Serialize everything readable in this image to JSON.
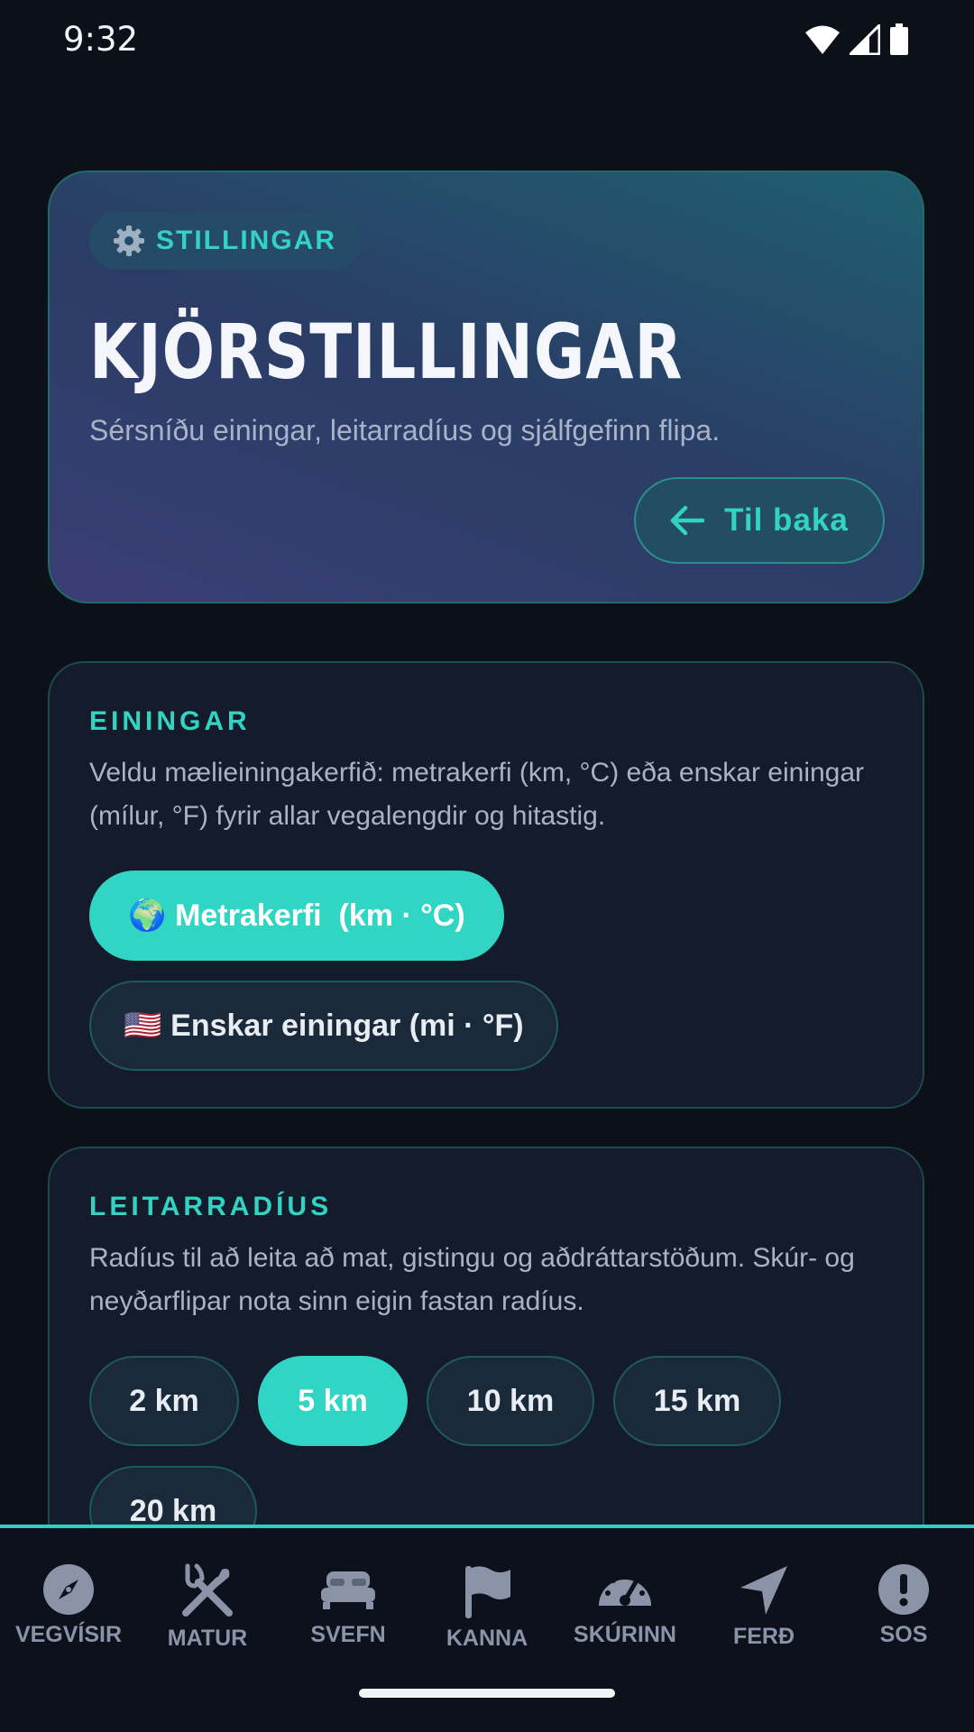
{
  "status_bar": {
    "time": "9:32"
  },
  "hero": {
    "chip_icon": "gear-icon",
    "chip_label": "STILLINGAR",
    "title": "KJÖRSTILLINGAR",
    "subtitle": "Sérsníðu einingar, leitarradíus og sjálfgefinn flipa.",
    "back_label": "Til baka"
  },
  "units_card": {
    "title": "EININGAR",
    "description": "Veldu mælieiningakerfið: metrakerfi (km, °C) eða enskar einingar (mílur, °F) fyrir allar vegalengdir og hitastig.",
    "options": [
      {
        "label": "🌍 Metrakerfi  (km · °C)",
        "selected": true
      },
      {
        "label": "🇺🇸 Enskar einingar (mi · °F)",
        "selected": false
      }
    ]
  },
  "radius_card": {
    "title": "LEITARRADÍUS",
    "description": "Radíus til að leita að mat, gistingu og aðdráttarstöðum. Skúr- og neyðarflipar nota sinn eigin fastan radíus.",
    "options": [
      {
        "label": "2 km",
        "selected": false
      },
      {
        "label": "5 km",
        "selected": true
      },
      {
        "label": "10 km",
        "selected": false
      },
      {
        "label": "15 km",
        "selected": false
      },
      {
        "label": "20 km",
        "selected": false
      }
    ]
  },
  "bottom_nav": [
    {
      "label": "VEGVÍSIR",
      "icon": "compass-icon"
    },
    {
      "label": "MATUR",
      "icon": "utensils-icon"
    },
    {
      "label": "SVEFN",
      "icon": "bed-icon"
    },
    {
      "label": "KANNA",
      "icon": "flag-icon"
    },
    {
      "label": "SKÚRINN",
      "icon": "speedometer-icon"
    },
    {
      "label": "FERÐ",
      "icon": "navigation-arrow-icon"
    },
    {
      "label": "SOS",
      "icon": "alert-icon"
    }
  ],
  "colors": {
    "accent": "#30d5c4",
    "background": "#0b1019",
    "card": "#141b2b"
  }
}
